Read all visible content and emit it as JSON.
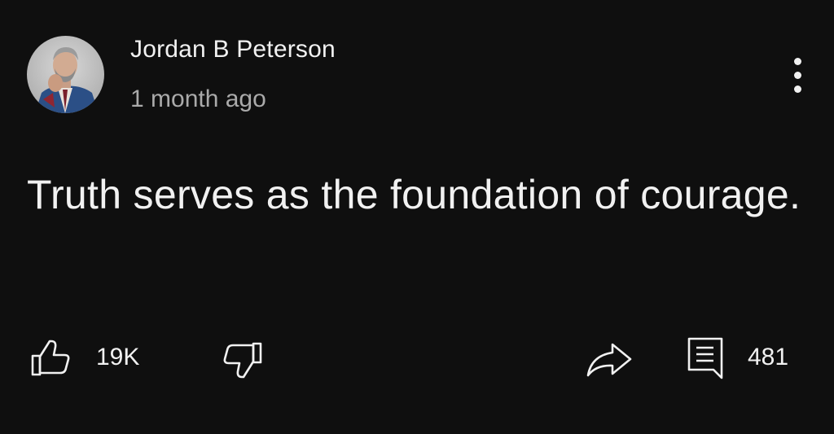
{
  "post": {
    "author": "Jordan B Peterson",
    "timestamp": "1 month ago",
    "text": "Truth serves as the foundation of courage.",
    "like_count": "19K",
    "comment_count": "481"
  },
  "icons": {
    "like": "thumbs-up-icon",
    "dislike": "thumbs-down-icon",
    "share": "share-arrow-icon",
    "comments": "comment-icon",
    "menu": "more-vertical-icon"
  },
  "colors": {
    "background": "#0f0f0f",
    "primary_text": "#f1f1f1",
    "secondary_text": "#aaaaaa"
  }
}
